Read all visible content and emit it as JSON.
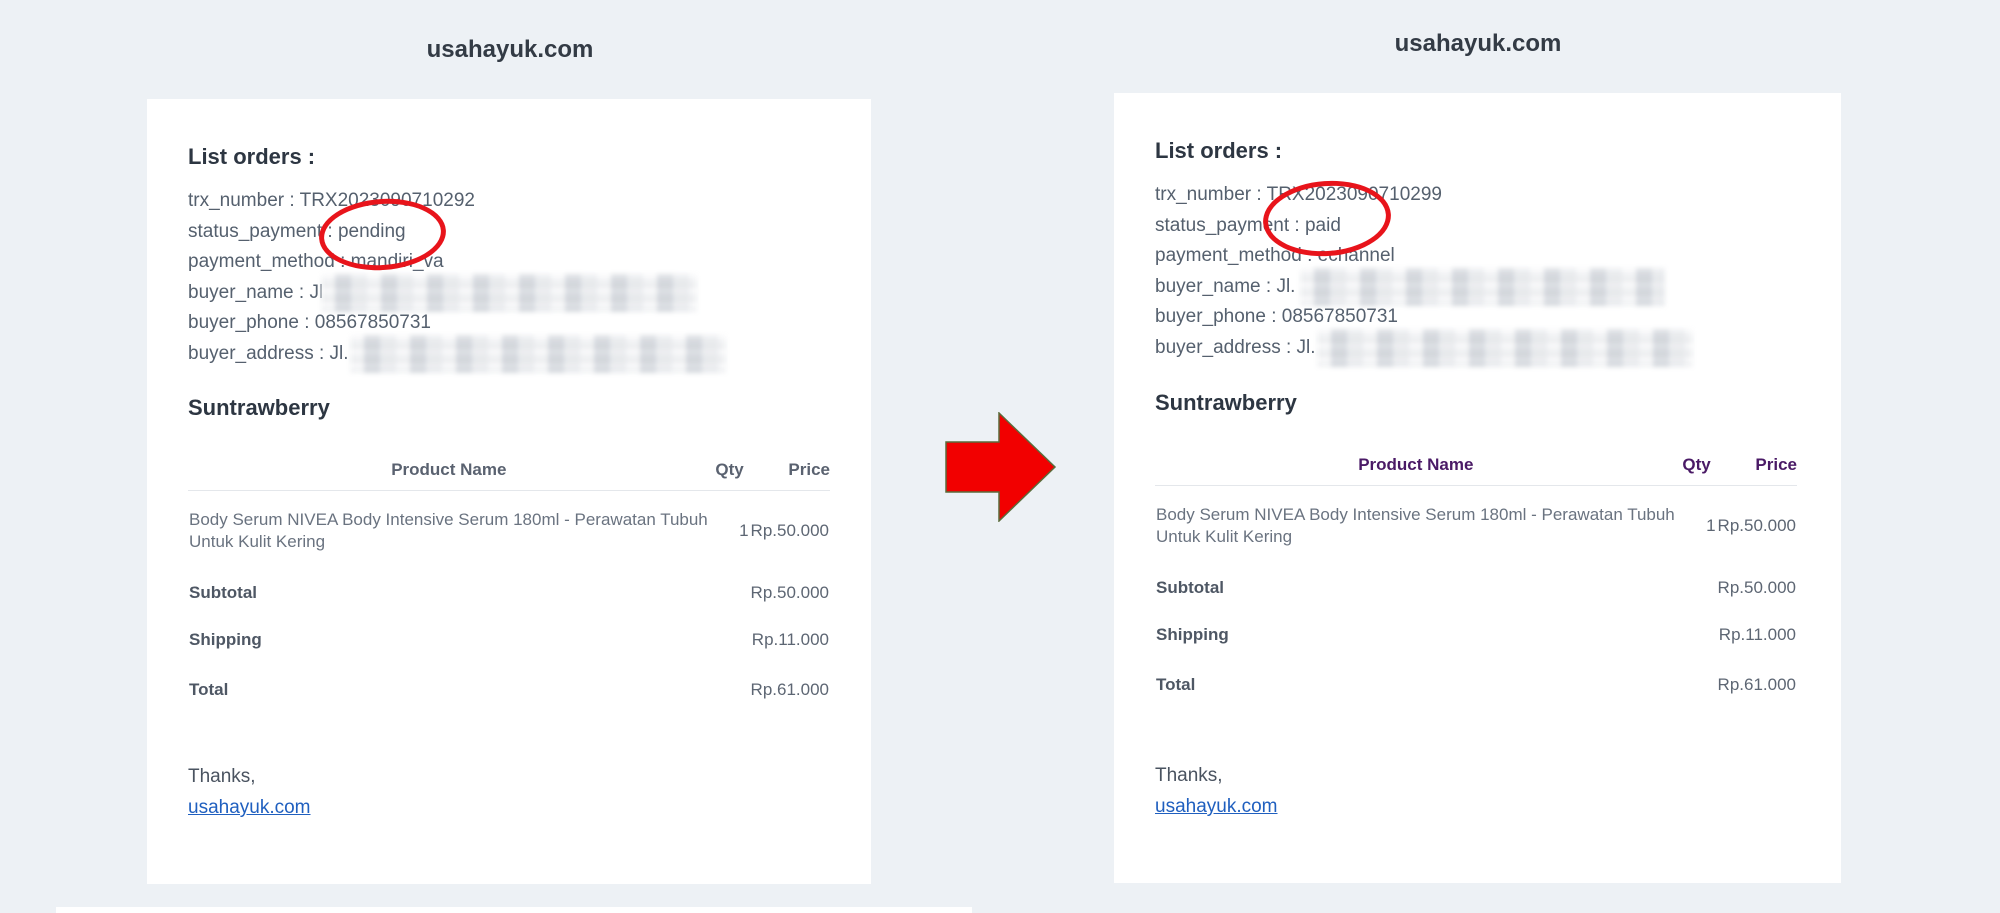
{
  "left": {
    "site_title": "usahayuk.com",
    "list_heading": "List orders :",
    "trx_number": "trx_number : TRX2023090710292",
    "status_payment": "status_payment : pending",
    "payment_method": "payment_method : mandiri_va",
    "buyer_name": "buyer_name : Jl",
    "buyer_phone": "buyer_phone : 08567850731",
    "buyer_address": "buyer_address : Jl.",
    "store_name": "Suntrawberry",
    "table": {
      "headers": [
        "Product Name",
        "Qty",
        "Price"
      ],
      "product": {
        "name": "Body Serum NIVEA Body Intensive Serum 180ml - Perawatan Tubuh Untuk Kulit Kering",
        "qty": "1",
        "price": "Rp.50.000"
      },
      "subtotal_label": "Subtotal",
      "subtotal": "Rp.50.000",
      "shipping_label": "Shipping",
      "shipping": "Rp.11.000",
      "total_label": "Total",
      "total": "Rp.61.000"
    },
    "thanks": "Thanks,",
    "link": "usahayuk.com"
  },
  "right": {
    "site_title": "usahayuk.com",
    "list_heading": "List orders :",
    "trx_number": "trx_number : TRX2023090710299",
    "status_payment": "status_payment : paid",
    "payment_method": "payment_method : echannel",
    "buyer_name": "buyer_name : Jl.",
    "buyer_phone": "buyer_phone : 08567850731",
    "buyer_address": "buyer_address : Jl.",
    "store_name": "Suntrawberry",
    "table": {
      "headers": [
        "Product Name",
        "Qty",
        "Price"
      ],
      "product": {
        "name": "Body Serum NIVEA Body Intensive Serum 180ml - Perawatan Tubuh Untuk Kulit Kering",
        "qty": "1",
        "price": "Rp.50.000"
      },
      "subtotal_label": "Subtotal",
      "subtotal": "Rp.50.000",
      "shipping_label": "Shipping",
      "shipping": "Rp.11.000",
      "total_label": "Total",
      "total": "Rp.61.000"
    },
    "thanks": "Thanks,",
    "link": "usahayuk.com"
  },
  "colors": {
    "background": "#edf1f5",
    "highlight_circle": "#e8141b",
    "arrow": "#f20000",
    "link": "#1f5fbf",
    "right_header": "#4a1a66"
  },
  "icons": [
    "right-arrow-icon"
  ]
}
